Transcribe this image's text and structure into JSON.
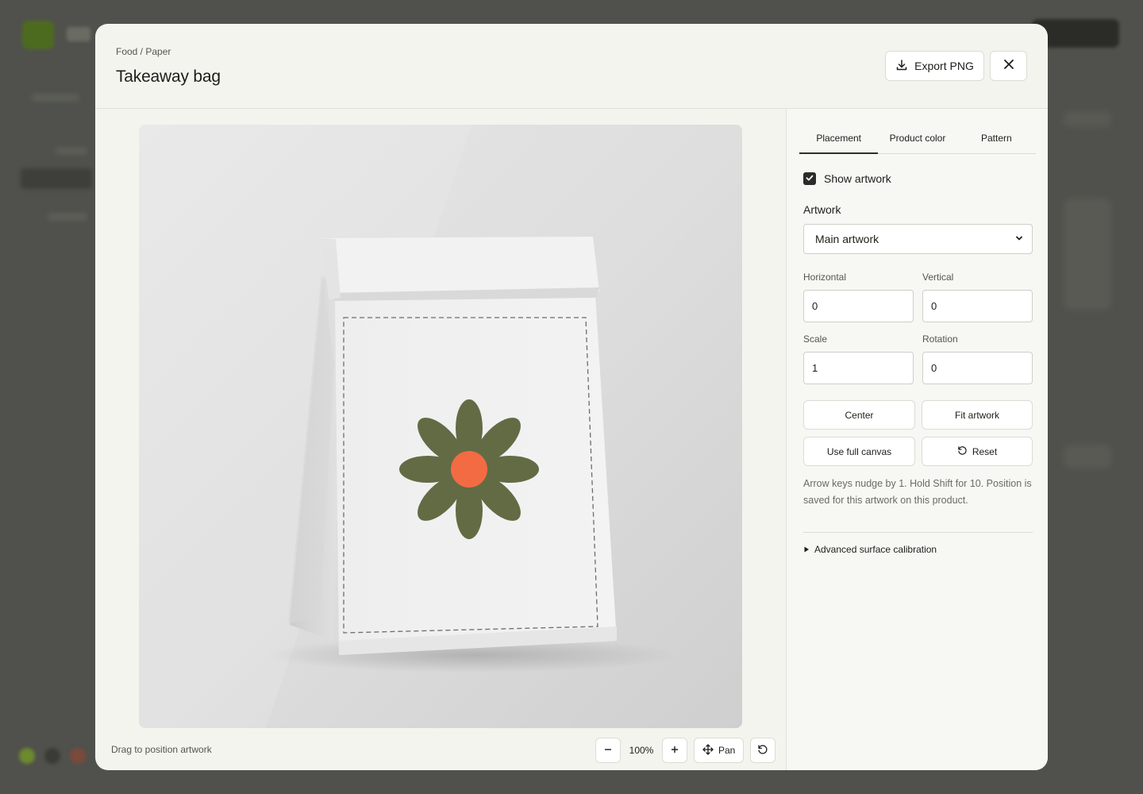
{
  "breadcrumb": "Food / Paper",
  "title": "Takeaway bag",
  "header_actions": {
    "export_label": "Export PNG"
  },
  "canvas": {
    "hint": "Drag to position artwork",
    "zoom_level": "100%",
    "pan_label": "Pan"
  },
  "tabs": [
    {
      "label": "Placement",
      "active": true
    },
    {
      "label": "Product color",
      "active": false
    },
    {
      "label": "Pattern",
      "active": false
    }
  ],
  "placement": {
    "show_artwork_label": "Show artwork",
    "show_artwork_checked": true,
    "artwork_label": "Artwork",
    "artwork_selected": "Main artwork",
    "horizontal_label": "Horizontal",
    "horizontal_value": "0",
    "vertical_label": "Vertical",
    "vertical_value": "0",
    "scale_label": "Scale",
    "scale_value": "1",
    "rotation_label": "Rotation",
    "rotation_value": "0",
    "center_label": "Center",
    "fit_label": "Fit artwork",
    "full_canvas_label": "Use full canvas",
    "reset_label": "Reset",
    "help_text": "Arrow keys nudge by 1. Hold Shift for 10. Position is saved for this artwork on this product.",
    "advanced_label": "Advanced surface calibration"
  },
  "colors": {
    "flower_petal": "#636b45",
    "flower_center": "#f26b43",
    "accent_dark": "#2b2b27"
  },
  "icons": {
    "export": "download-icon",
    "close": "close-icon",
    "zoom_out": "minus-icon",
    "zoom_in": "plus-icon",
    "pan": "move-icon",
    "reset_view": "rotate-ccw-icon",
    "checkbox": "check-icon",
    "select": "chevron-down-icon",
    "reset": "rotate-ccw-icon",
    "disclosure": "triangle-right-icon"
  }
}
